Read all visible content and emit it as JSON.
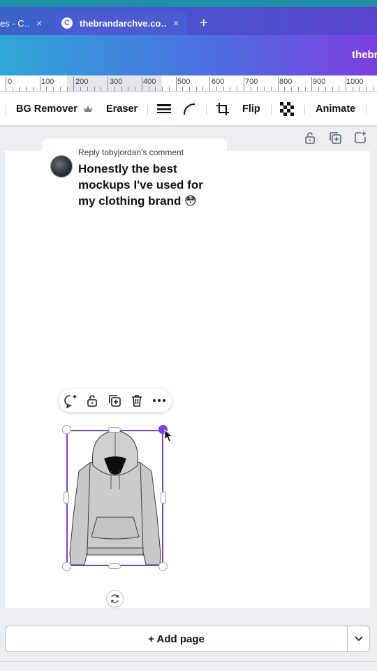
{
  "browser": {
    "tabs": [
      {
        "title": "es - C…",
        "active": false
      },
      {
        "title": "thebrandarchve.co…",
        "active": true,
        "favicon": "C"
      }
    ],
    "close_glyph": "×",
    "new_tab_glyph": "+"
  },
  "appbar": {
    "brand_peek": "thebr"
  },
  "ruler": {
    "labels": [
      "0",
      "100",
      "200",
      "300",
      "400",
      "500",
      "600",
      "700",
      "800",
      "900",
      "1000"
    ]
  },
  "toolbar": {
    "bg_remover": "BG Remover",
    "eraser": "Eraser",
    "flip": "Flip",
    "animate": "Animate"
  },
  "comment": {
    "reply_prefix": "Reply to",
    "reply_user": "byjordan",
    "reply_suffix": "'s comment",
    "text": "Honestly the best mockups I've used for my clothing brand 😳"
  },
  "add_page": {
    "label": "+ Add page"
  },
  "colors": {
    "selection": "#7a3fe0",
    "tabbar": "#4b5bd2"
  }
}
